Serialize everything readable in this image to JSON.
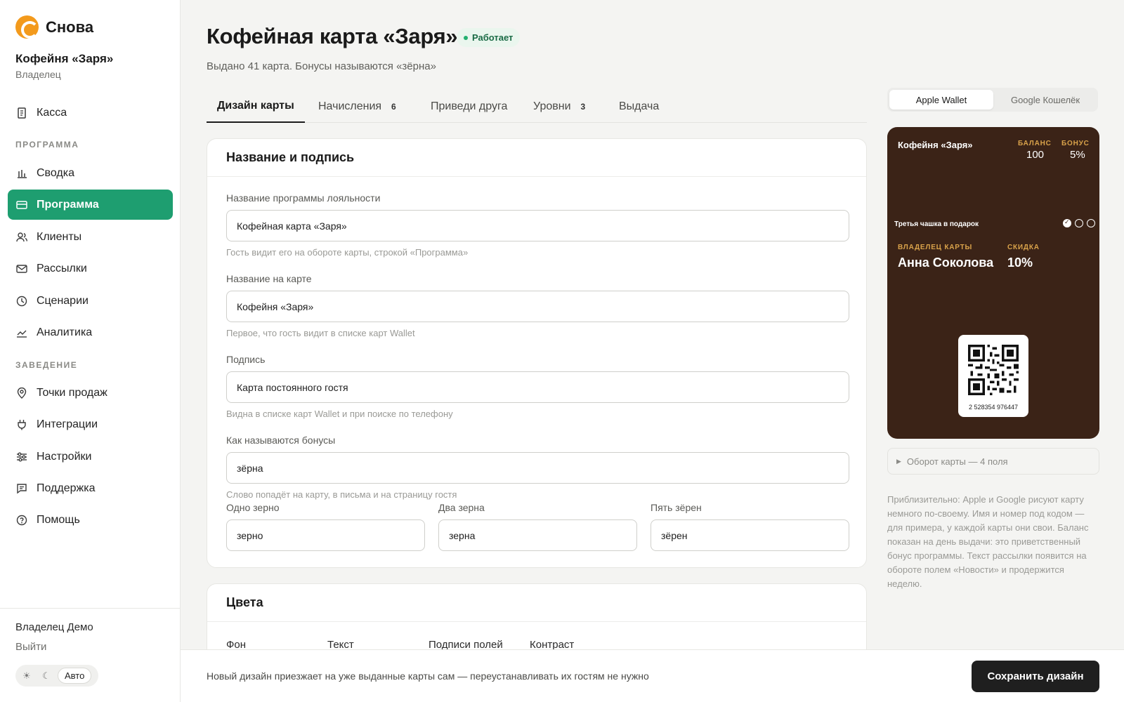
{
  "brand": {
    "name": "Снова"
  },
  "venue": {
    "name": "Кофейня «Заря»",
    "role": "Владелец"
  },
  "nav": {
    "cashier": "Касса",
    "section_program": "ПРОГРАММА",
    "summary": "Сводка",
    "program": "Программа",
    "clients": "Клиенты",
    "mailings": "Рассылки",
    "scenarios": "Сценарии",
    "analytics": "Аналитика",
    "section_venue": "ЗАВЕДЕНИЕ",
    "points": "Точки продаж",
    "integrations": "Интеграции",
    "settings": "Настройки",
    "support": "Поддержка",
    "help": "Помощь"
  },
  "account": {
    "user": "Владелец Демо",
    "logout": "Выйти",
    "theme_auto": "Авто"
  },
  "header": {
    "title": "Кофейная карта «Заря»",
    "status": "Работает",
    "subtitle": "Выдано 41 карта. Бонусы называются «зёрна»"
  },
  "tabs": [
    {
      "label": "Дизайн карты",
      "count": ""
    },
    {
      "label": "Начисления",
      "count": "6"
    },
    {
      "label": "Приведи друга",
      "count": ""
    },
    {
      "label": "Уровни",
      "count": "3"
    },
    {
      "label": "Выдача",
      "count": ""
    }
  ],
  "name_section": {
    "title": "Название и подпись",
    "program_name_label": "Название программы лояльности",
    "program_name_value": "Кофейная карта «Заря»",
    "program_name_hint": "Гость видит его на обороте карты, строкой «Программа»",
    "card_name_label": "Название на карте",
    "card_name_value": "Кофейня «Заря»",
    "card_name_hint": "Первое, что гость видит в списке карт Wallet",
    "caption_label": "Подпись",
    "caption_value": "Карта постоянного гостя",
    "caption_hint": "Видна в списке карт Wallet и при поиске по телефону",
    "bonus_label": "Как называются бонусы",
    "bonus_value": "зёрна",
    "bonus_hint": "Слово попадёт на карту, в письма и на страницу гостя",
    "one_label": "Одно зерно",
    "one_value": "зерно",
    "two_label": "Два зерна",
    "two_value": "зерна",
    "five_label": "Пять зёрен",
    "five_value": "зёрен"
  },
  "colors_section": {
    "title": "Цвета",
    "bg": "Фон",
    "text": "Текст",
    "field_labels": "Подписи полей",
    "contrast": "Контраст"
  },
  "preview": {
    "apple": "Apple Wallet",
    "google": "Google Кошелёк",
    "card_name": "Кофейня «Заря»",
    "balance_label": "БАЛАНС",
    "balance_value": "100",
    "bonus_label": "БОНУС",
    "bonus_value": "5%",
    "promo": "Третья чашка в подарок",
    "owner_label": "ВЛАДЕЛЕЦ КАРТЫ",
    "owner_value": "Анна Соколова",
    "discount_label": "СКИДКА",
    "discount_value": "10%",
    "barcode_number": "2 528354 976447",
    "reverse": "Оборот карты — 4 поля",
    "note": "Приблизительно: Apple и Google рисуют карту немного по-своему. Имя и номер под кодом — для примера, у каждой карты они свои. Баланс показан на день выдачи: это приветственный бонус программы. Текст рассылки появится на обороте полем «Новости» и продержится неделю.",
    "card_color": "#3b2317",
    "accent_label_color": "#d9a24a"
  },
  "footer": {
    "note": "Новый дизайн приезжает на уже выданные карты сам — переустанавливать их гостям не нужно",
    "save": "Сохранить дизайн"
  },
  "colors": {
    "accent": "#1e9e70",
    "brand": "#f39a1c",
    "dark_button": "#1f1f1f"
  }
}
